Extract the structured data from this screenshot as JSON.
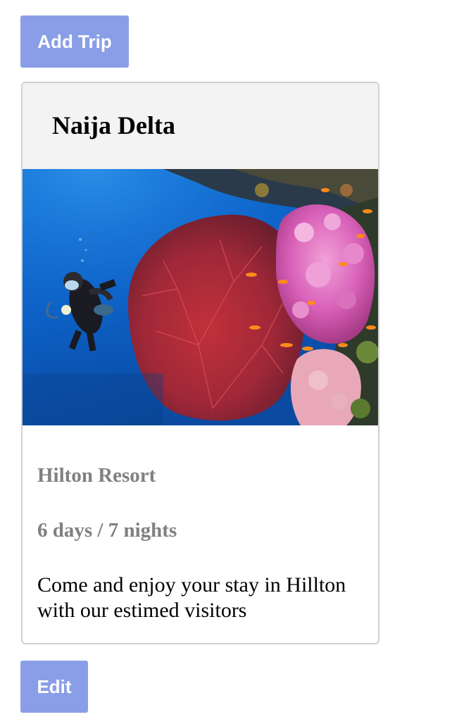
{
  "toolbar": {
    "add_trip_label": "Add Trip"
  },
  "trip": {
    "title": "Naija Delta",
    "image_alt": "scuba-diver-coral-reef-image",
    "resort": "Hilton Resort",
    "duration": "6 days / 7 nights",
    "description": "Come and enjoy your stay in Hillton with our estimed visitors"
  },
  "actions": {
    "edit_label": "Edit"
  },
  "colors": {
    "button_bg": "#8a9ee8",
    "button_text": "#ffffff",
    "header_bg": "#f3f3f3",
    "meta_text": "#808080",
    "card_border": "#d0d0d0"
  }
}
